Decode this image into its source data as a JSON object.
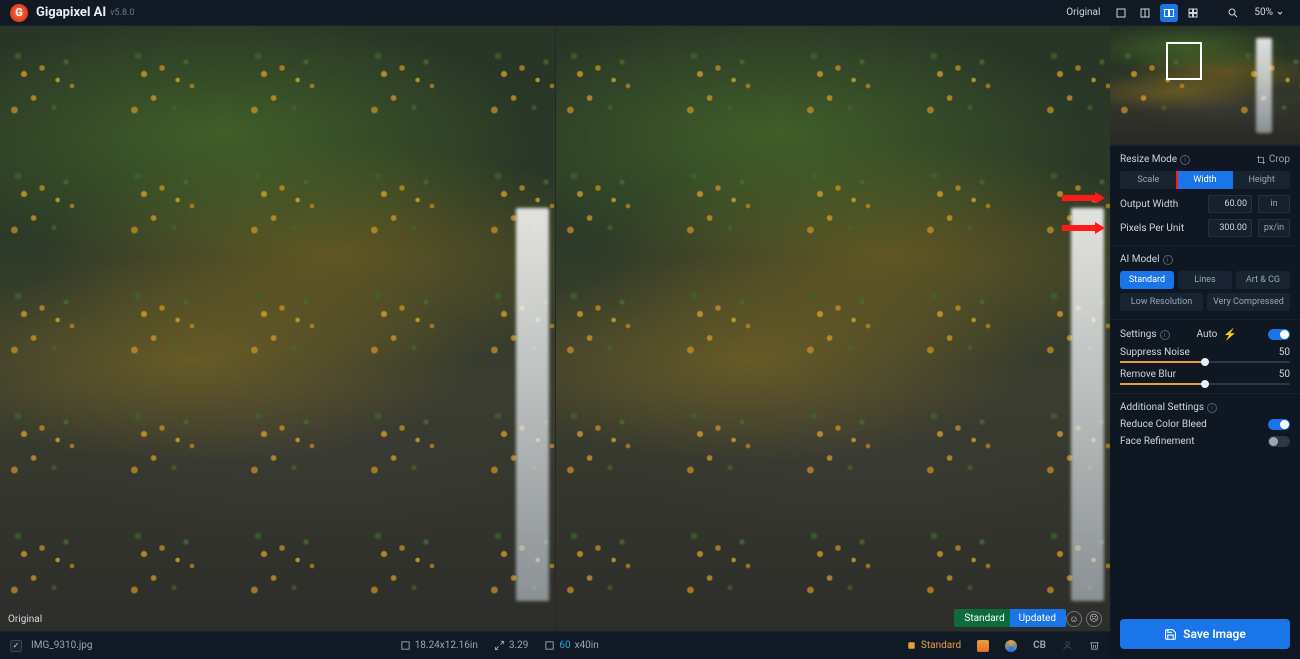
{
  "app": {
    "name": "Gigapixel AI",
    "version": "v5.8.0"
  },
  "topbar": {
    "original_label": "Original",
    "zoom": "50%"
  },
  "viewer": {
    "original_tag": "Original",
    "compare_left": "Standard",
    "compare_right": "Updated"
  },
  "status": {
    "filename": "IMG_9310.jpg",
    "dims": "18.24x12.16in",
    "scale": "3.29",
    "out_dims_prefix": "60",
    "out_dims_suffix": "x40in",
    "model": "Standard",
    "cb": "CB"
  },
  "sidebar": {
    "resize": {
      "title": "Resize Mode",
      "crop": "Crop",
      "tabs": {
        "scale": "Scale",
        "width": "Width",
        "height": "Height",
        "active": "width"
      },
      "output_width": {
        "label": "Output Width",
        "value": "60.00",
        "unit": "in"
      },
      "ppu": {
        "label": "Pixels Per Unit",
        "value": "300.00",
        "unit": "px/in"
      }
    },
    "model": {
      "title": "AI Model",
      "options": {
        "standard": "Standard",
        "lines": "Lines",
        "art": "Art & CG",
        "lowres": "Low Resolution",
        "verycomp": "Very Compressed",
        "active": "standard"
      }
    },
    "settings": {
      "title": "Settings",
      "auto": "Auto",
      "auto_on": true,
      "suppress_noise": {
        "label": "Suppress Noise",
        "value": "50"
      },
      "remove_blur": {
        "label": "Remove Blur",
        "value": "50"
      }
    },
    "additional": {
      "title": "Additional Settings",
      "reduce_color_bleed": {
        "label": "Reduce Color Bleed",
        "on": true
      },
      "face_refine": {
        "label": "Face Refinement",
        "on": false
      }
    },
    "save": "Save Image"
  }
}
